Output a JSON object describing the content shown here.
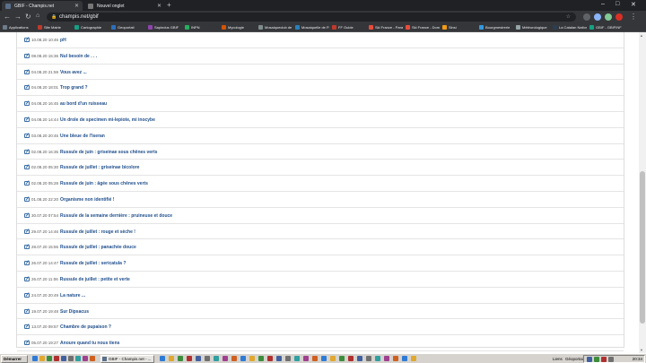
{
  "browser": {
    "tabs": [
      {
        "label": "GBIF - Champis.net",
        "active": true
      },
      {
        "label": "Nouvel onglet",
        "active": false
      }
    ],
    "new_tab_label": "+",
    "window_controls": {
      "minimize": "–",
      "maximize": "□",
      "close": "✕"
    },
    "address": "champis.net/gbif",
    "bookmarks": [
      {
        "label": "Applications",
        "color": "#6f7b8a"
      },
      {
        "label": "Site Mairie",
        "color": "#c0392b"
      },
      {
        "label": "Cartographie",
        "color": "#16a085"
      },
      {
        "label": "Geoportail",
        "color": "#2c6fbb"
      },
      {
        "label": "Sapindus GBIF",
        "color": "#8e44ad"
      },
      {
        "label": "INPN",
        "color": "#27ae60"
      },
      {
        "label": "Mycologie",
        "color": "#d35400"
      },
      {
        "label": "Mosaiqueclub de Papet - 1...",
        "color": "#7f8c8d"
      },
      {
        "label": "Mosaiquelle de Papet",
        "color": "#2980b9"
      },
      {
        "label": "FF Guide",
        "color": "#c0392b"
      },
      {
        "label": "Ski France - Paragne",
        "color": "#e74c3c"
      },
      {
        "label": "Ski France - Domaine",
        "color": "#e74c3c"
      },
      {
        "label": "Sinsi",
        "color": "#f39c12"
      },
      {
        "label": "Bourgmestrerie",
        "color": "#3498db"
      },
      {
        "label": "Météorologique",
        "color": "#95a5a6"
      },
      {
        "label": "La Catalan Nationale GI",
        "color": "#2c3e50"
      },
      {
        "label": "GBIF - GBIFINF",
        "color": "#16a085"
      }
    ]
  },
  "posts": [
    {
      "date": "10.08.20 10:46",
      "title": "pH"
    },
    {
      "date": "08.08.20 15:36",
      "title": "Nul besoin de . . ."
    },
    {
      "date": "04.08.20 21:59",
      "title": "Vous avez ..."
    },
    {
      "date": "04.08.20 18:01",
      "title": "Trop grand ?"
    },
    {
      "date": "04.08.20 16:45",
      "title": "au bord d'un ruisseau"
    },
    {
      "date": "04.08.20 14:44",
      "title": "Un drole de specimen mi-lepiote, mi inocybe"
    },
    {
      "date": "03.08.20 20:45",
      "title": "Une bleue de l'Iseran"
    },
    {
      "date": "02.08.20 16:35",
      "title": "Russule de juin : griseinae sous chênes verts"
    },
    {
      "date": "02.08.20 05:30",
      "title": "Russule de juillet : griseinae bicolore"
    },
    {
      "date": "02.08.20 05:28",
      "title": "Russule de juin : âgée sous chênes verts"
    },
    {
      "date": "01.08.20 22:20",
      "title": "Organisme non identifié !"
    },
    {
      "date": "30.07.20 07:54",
      "title": "Russule de la semaine dernière : pruineuse et douce"
    },
    {
      "date": "29.07.20 14:46",
      "title": "Russule de juillet : rouge et sèche !"
    },
    {
      "date": "28.07.20 15:55",
      "title": "Russule de juillet : panachée douce"
    },
    {
      "date": "26.07.20 14:47",
      "title": "Russule de juillet : sericatula ?"
    },
    {
      "date": "26.07.20 11:06",
      "title": "Russule de juillet : petite et verte"
    },
    {
      "date": "24.07.20 20:49",
      "title": "La nature ..."
    },
    {
      "date": "19.07.20 19:48",
      "title": "Sur Dipsacus"
    },
    {
      "date": "13.07.20 09:57",
      "title": "Chambre de pupaison ?"
    },
    {
      "date": "05.07.20 19:27",
      "title": "Anoure quand tu nous tiens"
    }
  ],
  "taskbar": {
    "start_label": "Démarrer",
    "active_task": "GBIF - Champis.net - ...",
    "tray_items": [
      "Liens",
      "Géoportail"
    ],
    "clock": "20:34"
  }
}
